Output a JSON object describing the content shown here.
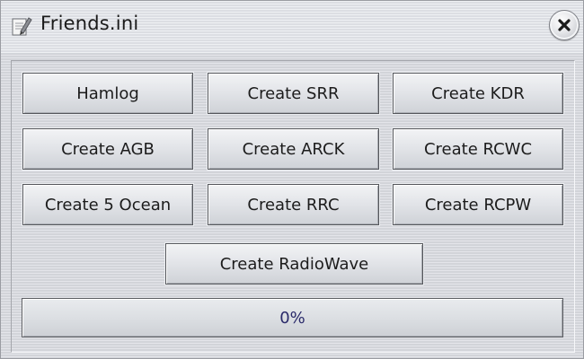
{
  "window": {
    "title": "Friends.ini",
    "icon": "notepad-pencil-icon",
    "close_icon": "close-x-icon"
  },
  "buttons": {
    "hamlog": "Hamlog",
    "create_srr": "Create SRR",
    "create_kdr": "Create KDR",
    "create_agb": "Create AGB",
    "create_arck": "Create ARCK",
    "create_rcwc": "Create RCWC",
    "create_5_ocean": "Create 5 Ocean",
    "create_rrc": "Create RRC",
    "create_rcpw": "Create RCPW",
    "create_radiowave": "Create RadioWave"
  },
  "progress": {
    "text": "0%",
    "value": 0
  },
  "colors": {
    "progress_text": "#2a2a6a",
    "button_border": "#55575c"
  }
}
